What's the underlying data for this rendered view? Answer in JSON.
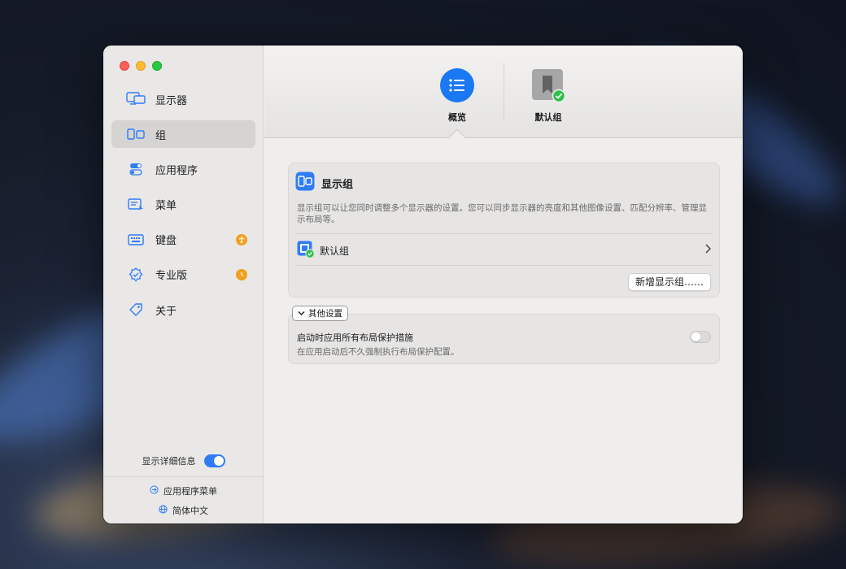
{
  "sidebar": {
    "items": [
      {
        "label": "显示器",
        "icon": "displays-icon"
      },
      {
        "label": "组",
        "icon": "groups-icon",
        "active": true
      },
      {
        "label": "应用程序",
        "icon": "apps-toggle-icon"
      },
      {
        "label": "菜单",
        "icon": "menu-icon"
      },
      {
        "label": "键盘",
        "icon": "keyboard-icon",
        "badge_icon": "accessibility-icon"
      },
      {
        "label": "专业版",
        "icon": "verified-badge-icon",
        "badge_icon": "clock-icon"
      },
      {
        "label": "关于",
        "icon": "tag-icon"
      }
    ],
    "show_details_label": "显示详细信息",
    "show_details_on": true,
    "app_menu_label": "应用程序菜单",
    "language_label": "简体中文"
  },
  "toolbar": {
    "tabs": [
      {
        "label": "概览",
        "icon": "list-icon",
        "active": true
      },
      {
        "label": "默认组",
        "icon": "bookmark-check-icon"
      }
    ]
  },
  "display_group": {
    "title": "显示组",
    "description": "显示组可以让您同时调整多个显示器的设置。您可以同步显示器的亮度和其他图像设置、匹配分辨率、管理显示布局等。",
    "default_group_label": "默认组",
    "add_button_label": "新增显示组……"
  },
  "other_settings": {
    "toggle_label": "其他设置",
    "setting_title": "启动时应用所有布局保护措施",
    "setting_desc": "在应用启动后不久强制执行布局保护配置。",
    "setting_on": false
  },
  "colors": {
    "accent": "#2f7cf6",
    "badge": "#f0a020",
    "check": "#2fbf4a"
  }
}
